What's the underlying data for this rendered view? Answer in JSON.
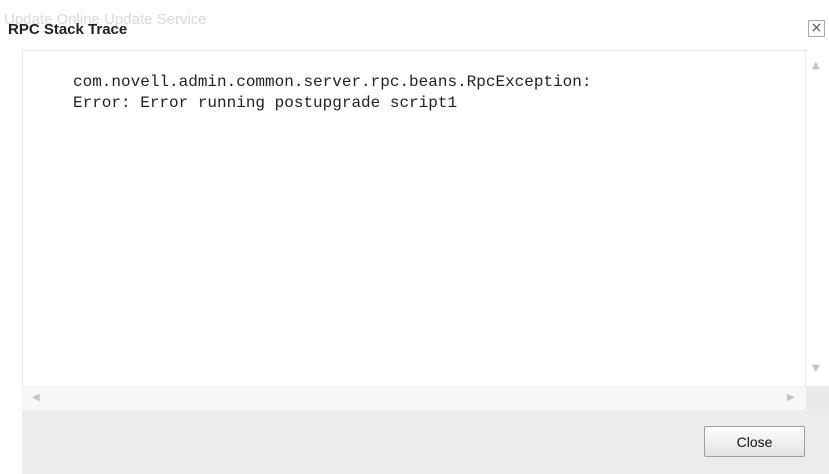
{
  "dialog": {
    "background_title": "Update Online Update Service",
    "title": "RPC Stack Trace",
    "close_glyph": "×",
    "trace_lines": [
      "com.novell.admin.common.server.rpc.beans.RpcException:",
      "Error: Error running postupgrade script1"
    ],
    "close_button_label": "Close"
  },
  "icons": {
    "scroll_up": "scroll-up-arrow-icon",
    "scroll_down": "scroll-down-arrow-icon",
    "scroll_left": "scroll-left-arrow-icon",
    "scroll_right": "scroll-right-arrow-icon",
    "close": "close-icon"
  },
  "colors": {
    "footer_bg": "#ececec",
    "content_bg": "#ffffff",
    "text": "#222222"
  }
}
